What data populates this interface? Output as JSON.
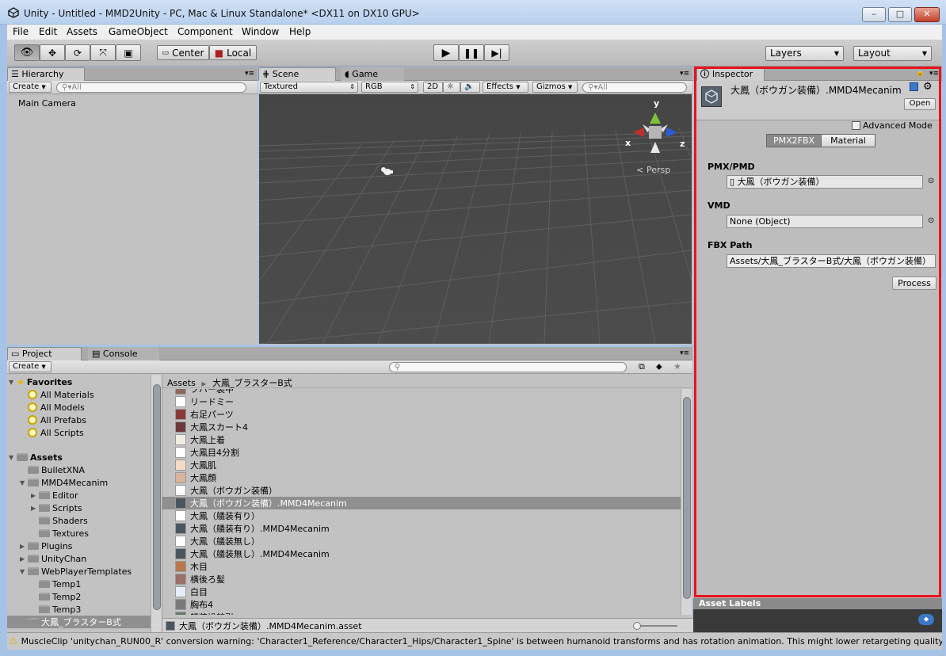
{
  "window": {
    "title": "Unity - Untitled - MMD2Unity - PC, Mac & Linux Standalone* <DX11 on DX10 GPU>",
    "controls": {
      "minimize": "–",
      "maximize": "□",
      "close": "✕"
    }
  },
  "menu": [
    "File",
    "Edit",
    "Assets",
    "GameObject",
    "Component",
    "Window",
    "Help"
  ],
  "toolbar": {
    "center_label": "Center",
    "local_label": "Local",
    "layers_label": "Layers",
    "layout_label": "Layout"
  },
  "hierarchy": {
    "tab": "Hierarchy",
    "create": "Create",
    "search_placeholder": "All",
    "items": [
      "Main Camera"
    ]
  },
  "scene": {
    "tab_scene": "Scene",
    "tab_game": "Game",
    "render_mode": "Textured",
    "color_mode": "RGB",
    "btn_2d": "2D",
    "effects": "Effects",
    "gizmos": "Gizmos",
    "search_placeholder": "All",
    "persp": "Persp",
    "axis_x": "x",
    "axis_y": "y",
    "axis_z": "z"
  },
  "project": {
    "tab_project": "Project",
    "tab_console": "Console",
    "create": "Create",
    "favorites_label": "Favorites",
    "favorites": [
      "All Materials",
      "All Models",
      "All Prefabs",
      "All Scripts"
    ],
    "assets_label": "Assets",
    "tree": [
      {
        "label": "BulletXNA",
        "depth": 1,
        "arrow": ""
      },
      {
        "label": "MMD4Mecanim",
        "depth": 1,
        "arrow": "▼"
      },
      {
        "label": "Editor",
        "depth": 2,
        "arrow": "▶"
      },
      {
        "label": "Scripts",
        "depth": 2,
        "arrow": "▶"
      },
      {
        "label": "Shaders",
        "depth": 2,
        "arrow": ""
      },
      {
        "label": "Textures",
        "depth": 2,
        "arrow": ""
      },
      {
        "label": "Plugins",
        "depth": 1,
        "arrow": "▶"
      },
      {
        "label": "UnityChan",
        "depth": 1,
        "arrow": "▶"
      },
      {
        "label": "WebPlayerTemplates",
        "depth": 1,
        "arrow": "▼"
      },
      {
        "label": "Temp1",
        "depth": 2,
        "arrow": ""
      },
      {
        "label": "Temp2",
        "depth": 2,
        "arrow": ""
      },
      {
        "label": "Temp3",
        "depth": 2,
        "arrow": ""
      },
      {
        "label": "大鳳_ブラスターB式",
        "depth": 1,
        "arrow": "",
        "selected": true
      }
    ],
    "breadcrumb_root": "Assets",
    "breadcrumb_folder": "大鳳_ブラスターB式",
    "files": [
      {
        "name": "フバー装中",
        "kind": "tex",
        "color": "#8a6a5a"
      },
      {
        "name": "リードミー",
        "kind": "doc"
      },
      {
        "name": "右足パーツ",
        "kind": "tex",
        "color": "#8b3a3a"
      },
      {
        "name": "大鳳スカート4",
        "kind": "tex",
        "color": "#6d3a3a"
      },
      {
        "name": "大鳳上着",
        "kind": "tex",
        "color": "#f2ede4"
      },
      {
        "name": "大鳳目4分割",
        "kind": "tex",
        "color": "#ffffff"
      },
      {
        "name": "大鳳肌",
        "kind": "tex",
        "color": "#f4ddc8"
      },
      {
        "name": "大鳳顔",
        "kind": "tex",
        "color": "#d8b49c"
      },
      {
        "name": "大鳳（ボウガン装備）",
        "kind": "doc"
      },
      {
        "name": "大鳳（ボウガン装備）.MMD4Mecanim",
        "kind": "asset",
        "selected": true
      },
      {
        "name": "大鳳（艤装有り）",
        "kind": "doc"
      },
      {
        "name": "大鳳（艤装有り）.MMD4Mecanim",
        "kind": "asset"
      },
      {
        "name": "大鳳（艤装無し）",
        "kind": "doc"
      },
      {
        "name": "大鳳（艤装無し）.MMD4Mecanim",
        "kind": "asset"
      },
      {
        "name": "木目",
        "kind": "tex",
        "color": "#b9774c"
      },
      {
        "name": "横後ろ髪",
        "kind": "tex",
        "color": "#9a7068"
      },
      {
        "name": "白目",
        "kind": "tex",
        "color": "#e8eef8"
      },
      {
        "name": "胸布4",
        "kind": "tex",
        "color": "#7a7a7a"
      },
      {
        "name": "艤装操舵引",
        "kind": "tex",
        "color": "#6a7a6a"
      }
    ],
    "footer_file": "大鳳（ボウガン装備）.MMD4Mecanim.asset"
  },
  "inspector": {
    "tab": "Inspector",
    "title": "大鳳（ボウガン装備）.MMD4Mecanim",
    "open_button": "Open",
    "advanced_mode": "Advanced Mode",
    "tabs": [
      "PMX2FBX",
      "Material"
    ],
    "pmx_label": "PMX/PMD",
    "pmx_value": "大鳳（ボウガン装備）",
    "vmd_label": "VMD",
    "vmd_value": "None (Object)",
    "fbx_label": "FBX Path",
    "fbx_value": "Assets/大鳳_ブラスターB式/大鳳（ボウガン装備）",
    "process_button": "Process",
    "asset_labels": "Asset Labels",
    "highlight_color": "#e8141c"
  },
  "status": {
    "message": "MuscleClip 'unitychan_RUN00_R' conversion warning: 'Character1_Reference/Character1_Hips/Character1_Spine' is between humanoid transforms and has rotation animation. This might lower retargeting quality."
  }
}
